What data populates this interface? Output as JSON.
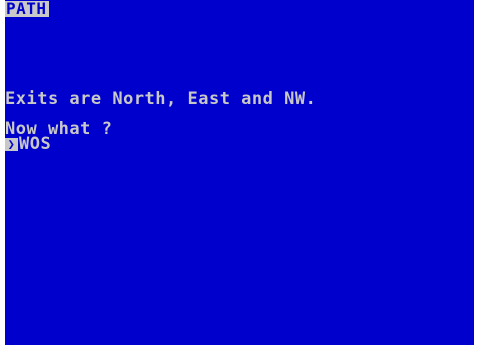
{
  "game": {
    "location_title": "PATH",
    "exits_text": "Exits are North, East and NW.",
    "prompt_text": "Now what ?",
    "cursor_glyph": "❯",
    "input_value": "WOS"
  },
  "colors": {
    "background": "#0000cd",
    "text": "#c8c8c8",
    "border": "#ffffff"
  }
}
